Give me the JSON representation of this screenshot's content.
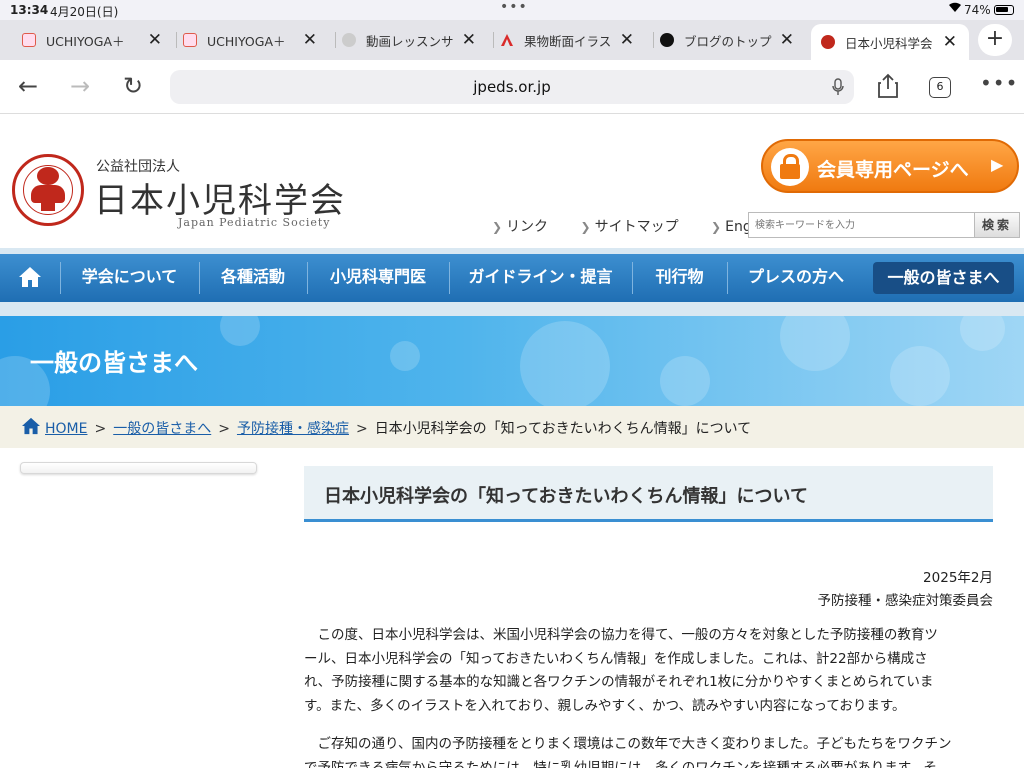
{
  "status_bar": {
    "time": "13:34",
    "date": "4月20日(日)",
    "battery": "74%"
  },
  "tabs": [
    {
      "title": "UCHIYOGA＋",
      "favicon_color": "#e05a4a"
    },
    {
      "title": "UCHIYOGA＋",
      "favicon_color": "#e05a4a"
    },
    {
      "title": "動画レッスンサ",
      "favicon_color": "#888888"
    },
    {
      "title": "果物断面イラス",
      "favicon_color": "#d92b2b"
    },
    {
      "title": "ブログのトップ",
      "favicon_color": "#111111"
    },
    {
      "title": "日本小児科学会",
      "favicon_color": "#c0281c",
      "active": true
    }
  ],
  "browser": {
    "url": "jpeds.or.jp",
    "tab_count": "6"
  },
  "header": {
    "org_type": "公益社団法人",
    "org_name": "日本小児科学会",
    "org_name_en": "Japan Pediatric Society",
    "member_button": "会員専用ページへ",
    "util_links": [
      "リンク",
      "サイトマップ",
      "English"
    ],
    "search_placeholder": "検索キーワードを入力",
    "search_button": "検索"
  },
  "nav": {
    "items": [
      "学会について",
      "各種活動",
      "小児科専門医",
      "ガイドライン・提言",
      "刊行物",
      "プレスの方へ"
    ],
    "active_item": "一般の皆さまへ"
  },
  "hero": {
    "title": "一般の皆さまへ"
  },
  "breadcrumb": {
    "home": "HOME",
    "level1": "一般の皆さまへ",
    "level2": "予防接種・感染症",
    "current": "日本小児科学会の「知っておきたいわくちん情報」について"
  },
  "article": {
    "title": "日本小児科学会の「知っておきたいわくちん情報」について",
    "date": "2025年2月",
    "committee": "予防接種・感染症対策委員会",
    "paragraph1_lines": [
      "　この度、日本小児科学会は、米国小児科学会の協力を得て、一般の方々を対象とした予防接種の教育ツ",
      "ール、日本小児科学会の「知っておきたいわくちん情報」を作成しました。これは、計22部から構成さ",
      "れ、予防接種に関する基本的な知識と各ワクチンの情報がそれぞれ1枚に分かりやすくまとめられていま",
      "す。また、多くのイラストを入れており、親しみやすく、かつ、読みやすい内容になっております。"
    ],
    "paragraph2_lines": [
      "　ご存知の通り、国内の予防接種をとりまく環境はこの数年で大きく変わりました。子どもたちをワクチン",
      "で予防できる病気から守るためには、特に乳幼児期には、多くのワクチンを接種する必要があります。そ"
    ]
  },
  "colors": {
    "nav_blue": "#1f6eb3",
    "nav_active": "#184e86",
    "member_orange": "#f07a10",
    "link_blue": "#1a5ea8",
    "logo_red": "#c0281c"
  }
}
